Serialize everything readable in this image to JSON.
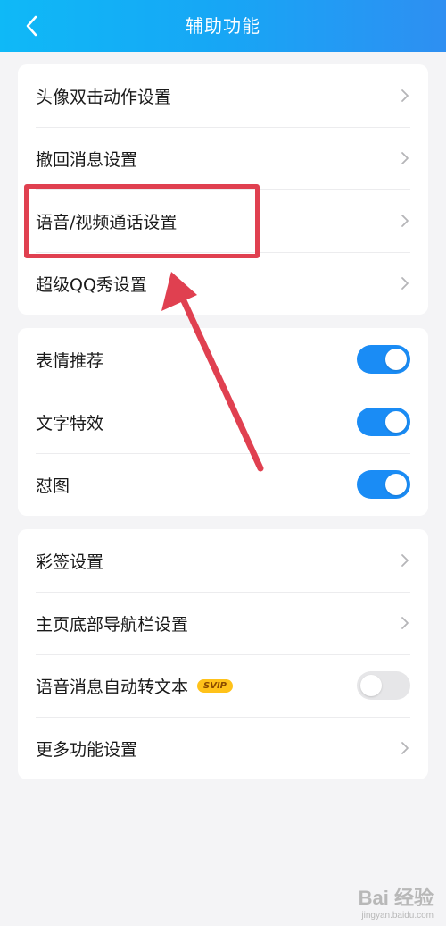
{
  "header": {
    "title": "辅助功能",
    "back_icon": "chevron-left-icon"
  },
  "groups": [
    {
      "items": [
        {
          "label": "头像双击动作设置",
          "type": "link"
        },
        {
          "label": "撤回消息设置",
          "type": "link"
        },
        {
          "label": "语音/视频通话设置",
          "type": "link"
        },
        {
          "label": "超级QQ秀设置",
          "type": "link"
        }
      ]
    },
    {
      "items": [
        {
          "label": "表情推荐",
          "type": "toggle",
          "on": true
        },
        {
          "label": "文字特效",
          "type": "toggle",
          "on": true
        },
        {
          "label": "怼图",
          "type": "toggle",
          "on": true
        }
      ]
    },
    {
      "items": [
        {
          "label": "彩签设置",
          "type": "link"
        },
        {
          "label": "主页底部导航栏设置",
          "type": "link"
        },
        {
          "label": "语音消息自动转文本",
          "type": "toggle",
          "on": false,
          "badge": "SVIP"
        },
        {
          "label": "更多功能设置",
          "type": "link"
        }
      ]
    }
  ],
  "watermark": {
    "main": "Bai 经验",
    "sub": "jingyan.baidu.com"
  },
  "colors": {
    "toggle_on": "#1a8cf5",
    "toggle_off": "#e6e6e8",
    "chevron": "#b5b5b8",
    "badge_bg": "#ffc21a",
    "badge_text": "#8a4a00",
    "annotation": "#e04050"
  }
}
